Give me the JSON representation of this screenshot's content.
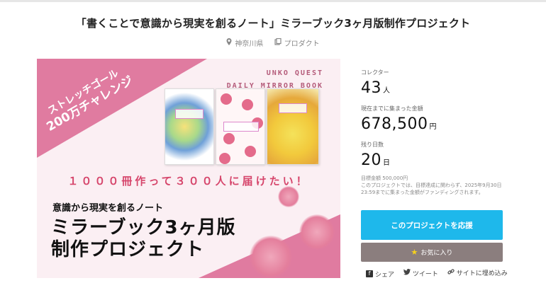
{
  "project": {
    "title": "「書くことで意識から現実を創るノート」ミラーブック3ヶ月版制作プロジェクト",
    "location": "神奈川県",
    "category": "プロダクト"
  },
  "hero": {
    "stretch_line1": "ストレッチゴール",
    "stretch_line2": "200万チャレンジ",
    "brand_line1": "UNKO QUEST",
    "brand_line2": "DAILY MIRROR BOOK",
    "goal_text": "１０００冊作って３００人に届けたい！",
    "subtitle": "意識から現実を創るノート",
    "title_line1": "ミラーブック3ヶ月版",
    "title_line2": "制作プロジェクト",
    "colors": {
      "accent": "#e07ba0",
      "goal": "#d6456b"
    }
  },
  "stats": {
    "collectors_label": "コレクター",
    "collectors_value": "43",
    "collectors_unit": "人",
    "raised_label": "現在までに集まった金額",
    "raised_value": "678,500",
    "raised_unit": "円",
    "days_label": "残り日数",
    "days_value": "20",
    "days_unit": "日",
    "target_text": "目標金額 500,000円",
    "note_text": "このプロジェクトでは、目標達成に関わらず、2025年9月30日23:59までに集まった金額がファンディングされます。"
  },
  "actions": {
    "support_label": "このプロジェクトを応援",
    "favorite_label": "お気に入り",
    "share_label": "シェア",
    "tweet_label": "ツイート",
    "embed_label": "サイトに埋め込み",
    "colors": {
      "support": "#1eb8eb",
      "favorite": "#8b7e7e"
    }
  }
}
